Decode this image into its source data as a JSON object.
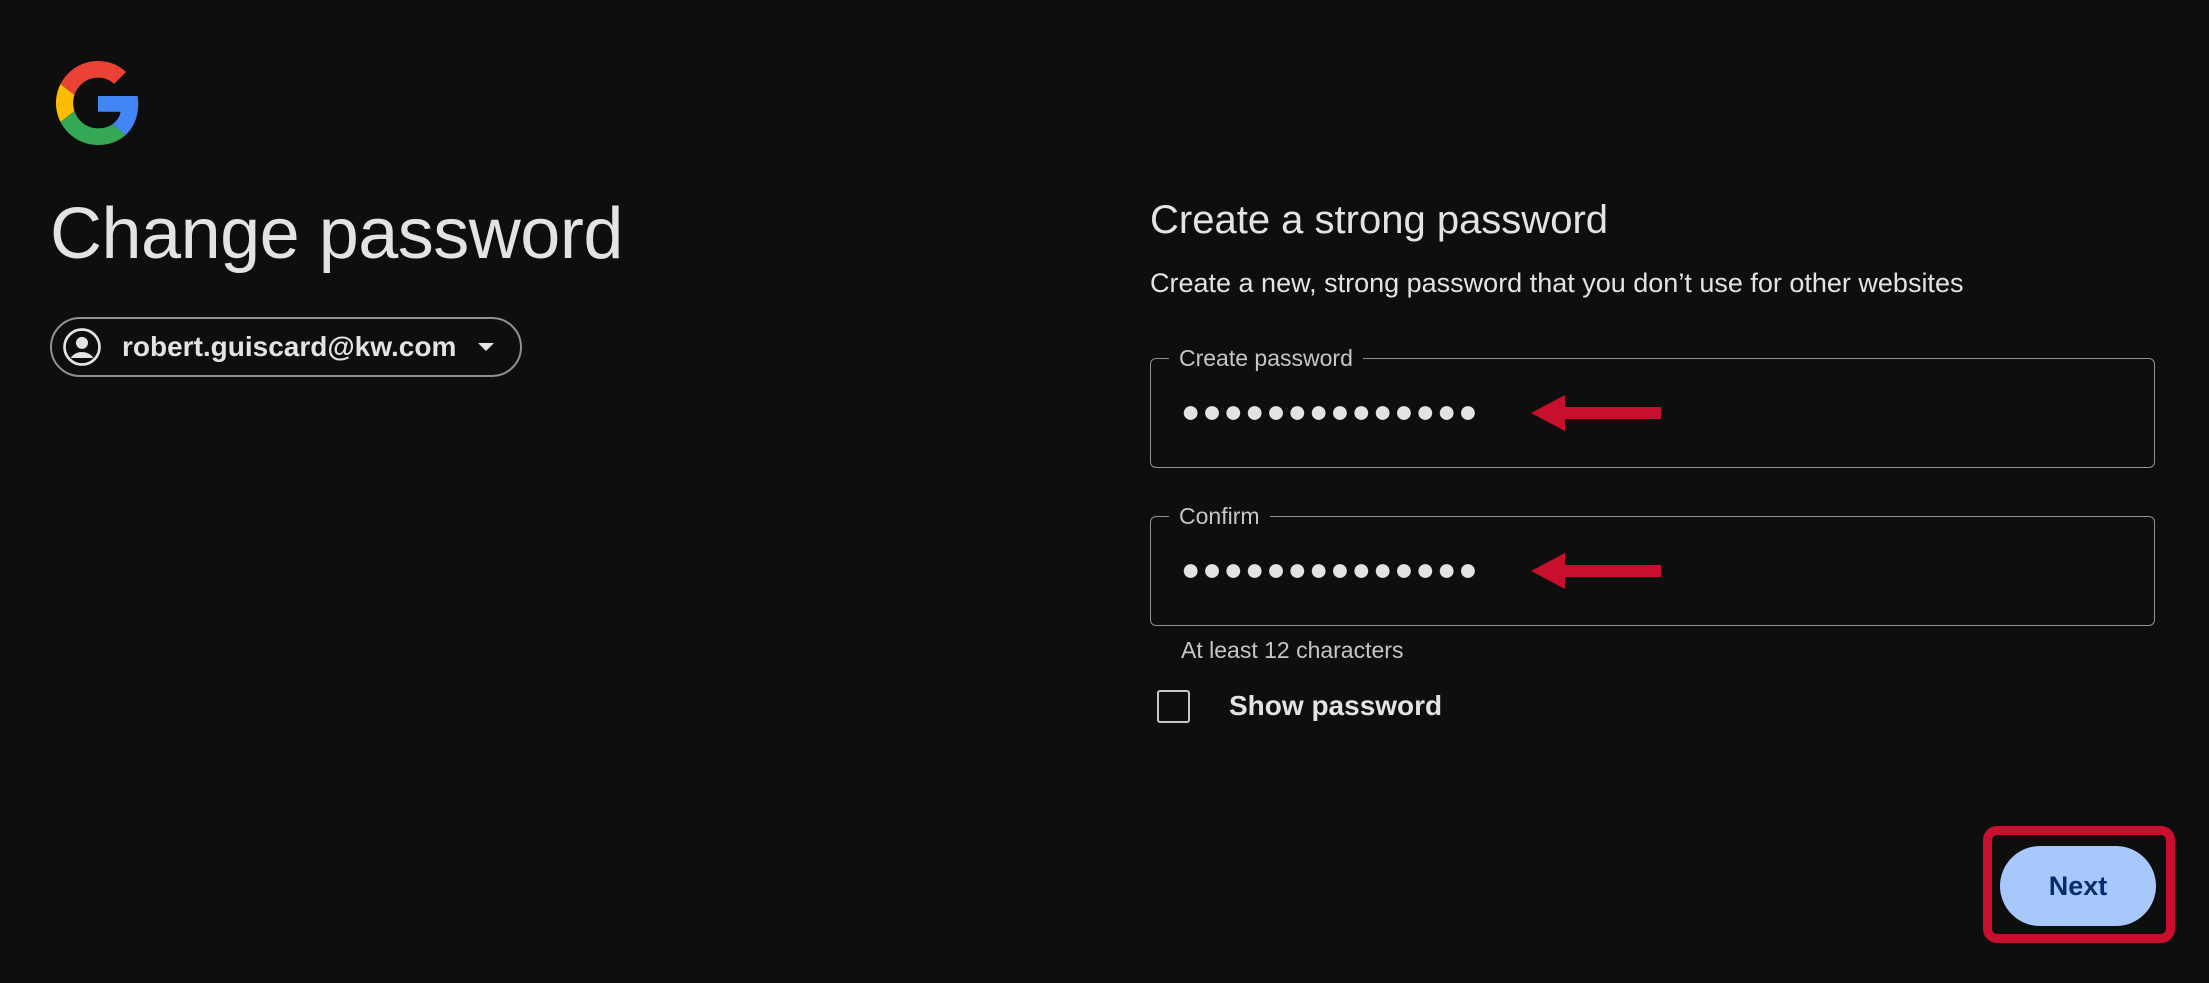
{
  "header": {
    "logo_icon": "google-g-logo",
    "page_title": "Change password"
  },
  "account": {
    "icon": "account-circle-icon",
    "email": "robert.guiscard@kw.com",
    "dropdown_icon": "caret-down-icon"
  },
  "form": {
    "title": "Create a strong password",
    "description": "Create a new, strong password that you don’t use for other websites",
    "fields": [
      {
        "label": "Create password",
        "value": "●●●●●●●●●●●●●●"
      },
      {
        "label": "Confirm",
        "value": "●●●●●●●●●●●●●●"
      }
    ],
    "hint": "At least 12 characters",
    "show_password_label": "Show password",
    "show_password_checked": false,
    "next_label": "Next"
  },
  "annotations": {
    "color": "#c8102e",
    "arrow_icon": "red-arrow-left-icon"
  },
  "colors": {
    "background": "#0e0e0e",
    "text": "#e3e3e3",
    "button_bg": "#a8c7fa",
    "button_text": "#062e6f",
    "border": "#8e918f"
  }
}
